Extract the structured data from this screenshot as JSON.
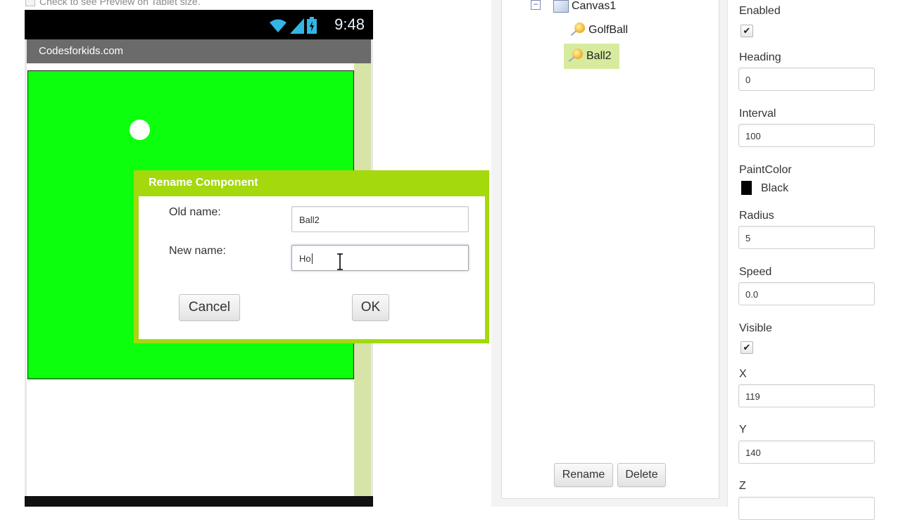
{
  "preview": {
    "tablet_checkbox_label": "Check to see Preview on Tablet size."
  },
  "phone": {
    "status_time": "9:48",
    "app_title": "Codesforkids.com",
    "canvas_color": "#0cff0c"
  },
  "components": {
    "tree": [
      {
        "name": "Canvas1",
        "icon": "canvas-icon"
      },
      {
        "name": "GolfBall",
        "icon": "ball-sprite-icon"
      },
      {
        "name": "Ball2",
        "icon": "ball-sprite-icon",
        "selected": true
      }
    ],
    "rename_label": "Rename",
    "delete_label": "Delete"
  },
  "properties": {
    "enabled_label": "Enabled",
    "enabled_checked": true,
    "heading_label": "Heading",
    "heading_value": "0",
    "interval_label": "Interval",
    "interval_value": "100",
    "paintcolor_label": "PaintColor",
    "paintcolor_value": "Black",
    "paintcolor_hex": "#000000",
    "radius_label": "Radius",
    "radius_value": "5",
    "speed_label": "Speed",
    "speed_value": "0.0",
    "visible_label": "Visible",
    "visible_checked": true,
    "x_label": "X",
    "x_value": "119",
    "y_label": "Y",
    "y_value": "140",
    "z_label": "Z"
  },
  "dialog": {
    "title": "Rename Component",
    "old_name_label": "Old name:",
    "old_name_value": "Ball2",
    "new_name_label": "New name:",
    "new_name_value": "Ho",
    "cancel_label": "Cancel",
    "ok_label": "OK",
    "accent": "#a3d90d"
  }
}
